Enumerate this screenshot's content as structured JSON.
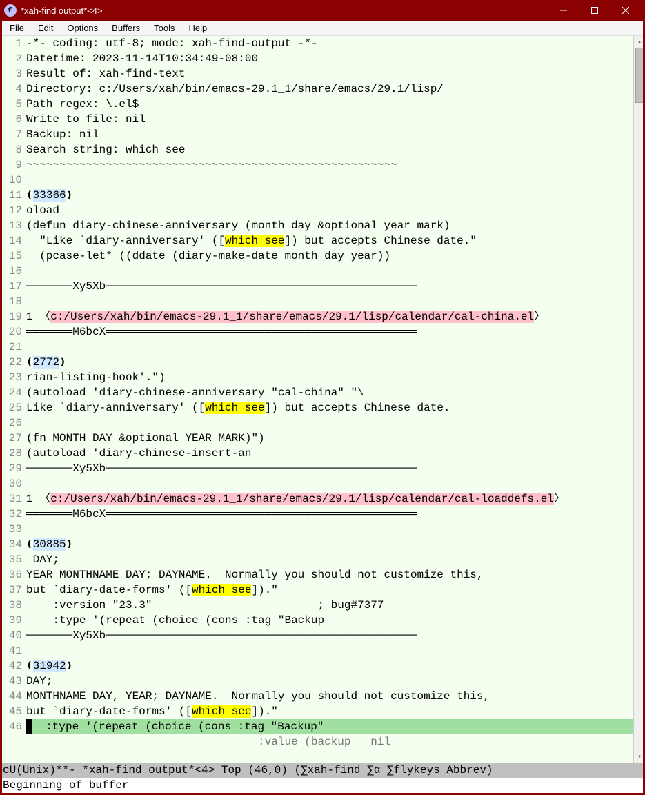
{
  "window": {
    "title": "*xah-find output*<4>",
    "app_icon_char": "€"
  },
  "menubar": [
    "File",
    "Edit",
    "Options",
    "Buffers",
    "Tools",
    "Help"
  ],
  "lines": [
    {
      "n": "1",
      "segs": [
        {
          "t": "-*- coding: utf-8; mode: xah-find-output -*-"
        }
      ]
    },
    {
      "n": "2",
      "segs": [
        {
          "t": "Datetime: 2023-11-14T10:34:49-08:00"
        }
      ]
    },
    {
      "n": "3",
      "segs": [
        {
          "t": "Result of: xah-find-text"
        }
      ]
    },
    {
      "n": "4",
      "segs": [
        {
          "t": "Directory: c:/Users/xah/bin/emacs-29.1_1/share/emacs/29.1/lisp/"
        }
      ]
    },
    {
      "n": "5",
      "segs": [
        {
          "t": "Path regex: \\.el$"
        }
      ]
    },
    {
      "n": "6",
      "segs": [
        {
          "t": "Write to file: nil"
        }
      ]
    },
    {
      "n": "7",
      "segs": [
        {
          "t": "Backup: nil"
        }
      ]
    },
    {
      "n": "8",
      "segs": [
        {
          "t": "Search string: which see"
        }
      ]
    },
    {
      "n": "9",
      "segs": [
        {
          "t": "~~~~~~~~~~~~~~~~~~~~~~~~~~~~~~~~~~~~~~~~~~~~~~~~~~~~~~~~"
        }
      ]
    },
    {
      "n": "10",
      "segs": [
        {
          "t": ""
        }
      ]
    },
    {
      "n": "11",
      "segs": [
        {
          "t": "❪"
        },
        {
          "t": "33366",
          "c": "hl-cyan"
        },
        {
          "t": "❫"
        }
      ]
    },
    {
      "n": "12",
      "segs": [
        {
          "t": "oload"
        }
      ]
    },
    {
      "n": "13",
      "segs": [
        {
          "t": "(defun diary-chinese-anniversary (month day &optional year mark)"
        }
      ]
    },
    {
      "n": "14",
      "segs": [
        {
          "t": "  \"Like `diary-anniversary' (["
        },
        {
          "t": "which see",
          "c": "hl-yellow"
        },
        {
          "t": "]) but accepts Chinese date.\""
        }
      ]
    },
    {
      "n": "15",
      "segs": [
        {
          "t": "  (pcase-let* ((ddate (diary-make-date month day year))"
        }
      ]
    },
    {
      "n": "16",
      "segs": [
        {
          "t": ""
        }
      ]
    },
    {
      "n": "17",
      "segs": [
        {
          "t": "───────Xy5Xb───────────────────────────────────────────────"
        }
      ]
    },
    {
      "n": "18",
      "segs": [
        {
          "t": ""
        }
      ]
    },
    {
      "n": "19",
      "segs": [
        {
          "t": "1 〈"
        },
        {
          "t": "c:/Users/xah/bin/emacs-29.1_1/share/emacs/29.1/lisp/calendar/cal-china.el",
          "c": "hl-pink"
        },
        {
          "t": "〉"
        }
      ]
    },
    {
      "n": "20",
      "segs": [
        {
          "t": "═══════M6bcX═══════════════════════════════════════════════"
        }
      ]
    },
    {
      "n": "21",
      "segs": [
        {
          "t": ""
        }
      ]
    },
    {
      "n": "22",
      "segs": [
        {
          "t": "❪"
        },
        {
          "t": "2772",
          "c": "hl-cyan"
        },
        {
          "t": "❫"
        }
      ]
    },
    {
      "n": "23",
      "segs": [
        {
          "t": "rian-listing-hook'.\")"
        }
      ]
    },
    {
      "n": "24",
      "segs": [
        {
          "t": "(autoload 'diary-chinese-anniversary \"cal-china\" \"\\"
        }
      ]
    },
    {
      "n": "25",
      "segs": [
        {
          "t": "Like `diary-anniversary' (["
        },
        {
          "t": "which see",
          "c": "hl-yellow"
        },
        {
          "t": "]) but accepts Chinese date."
        }
      ]
    },
    {
      "n": "26",
      "segs": [
        {
          "t": ""
        }
      ]
    },
    {
      "n": "27",
      "segs": [
        {
          "t": "(fn MONTH DAY &optional YEAR MARK)\")"
        }
      ]
    },
    {
      "n": "28",
      "segs": [
        {
          "t": "(autoload 'diary-chinese-insert-an"
        }
      ]
    },
    {
      "n": "29",
      "segs": [
        {
          "t": "───────Xy5Xb───────────────────────────────────────────────"
        }
      ]
    },
    {
      "n": "30",
      "segs": [
        {
          "t": ""
        }
      ]
    },
    {
      "n": "31",
      "segs": [
        {
          "t": "1 〈"
        },
        {
          "t": "c:/Users/xah/bin/emacs-29.1_1/share/emacs/29.1/lisp/calendar/cal-loaddefs.el",
          "c": "hl-pink"
        },
        {
          "t": "〉"
        }
      ]
    },
    {
      "n": "32",
      "segs": [
        {
          "t": "═══════M6bcX═══════════════════════════════════════════════"
        }
      ]
    },
    {
      "n": "33",
      "segs": [
        {
          "t": ""
        }
      ]
    },
    {
      "n": "34",
      "segs": [
        {
          "t": "❪"
        },
        {
          "t": "30885",
          "c": "hl-cyan"
        },
        {
          "t": "❫"
        }
      ]
    },
    {
      "n": "35",
      "segs": [
        {
          "t": " DAY;"
        }
      ]
    },
    {
      "n": "36",
      "segs": [
        {
          "t": "YEAR MONTHNAME DAY; DAYNAME.  Normally you should not customize this,"
        }
      ]
    },
    {
      "n": "37",
      "segs": [
        {
          "t": "but `diary-date-forms' (["
        },
        {
          "t": "which see",
          "c": "hl-yellow"
        },
        {
          "t": "]).\""
        }
      ]
    },
    {
      "n": "38",
      "segs": [
        {
          "t": "    :version \"23.3\"                         ; bug#7377"
        }
      ]
    },
    {
      "n": "39",
      "segs": [
        {
          "t": "    :type '(repeat (choice (cons :tag \"Backup"
        }
      ]
    },
    {
      "n": "40",
      "segs": [
        {
          "t": "───────Xy5Xb───────────────────────────────────────────────"
        }
      ]
    },
    {
      "n": "41",
      "segs": [
        {
          "t": ""
        }
      ]
    },
    {
      "n": "42",
      "segs": [
        {
          "t": "❪"
        },
        {
          "t": "31942",
          "c": "hl-cyan"
        },
        {
          "t": "❫"
        }
      ]
    },
    {
      "n": "43",
      "segs": [
        {
          "t": "DAY;"
        }
      ]
    },
    {
      "n": "44",
      "segs": [
        {
          "t": "MONTHNAME DAY, YEAR; DAYNAME.  Normally you should not customize this,"
        }
      ]
    },
    {
      "n": "45",
      "segs": [
        {
          "t": "but `diary-date-forms' (["
        },
        {
          "t": "which see",
          "c": "hl-yellow"
        },
        {
          "t": "]).\""
        }
      ]
    },
    {
      "n": "46",
      "cursorline": true,
      "segs": [
        {
          "t": " ",
          "c": "cursor-block"
        },
        {
          "t": "  :type '(repeat (choice (cons :tag \"Backup\""
        }
      ]
    },
    {
      "n": "",
      "segs": [
        {
          "t": "                                   :value (backup   nil",
          "c": "gray"
        }
      ]
    }
  ],
  "modeline": "cU(Unix)**- *xah-find output*<4> Top (46,0) (∑xah-find ∑α ∑flykeys Abbrev)",
  "minibuffer": "Beginning of buffer"
}
